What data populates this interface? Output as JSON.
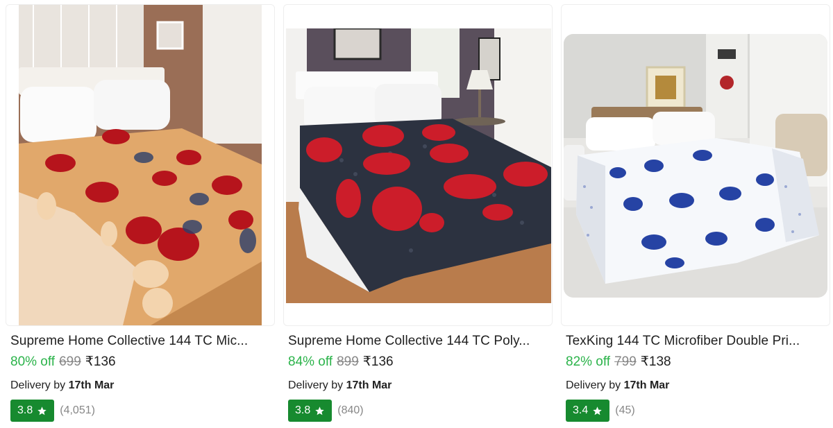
{
  "products": [
    {
      "title": "Supreme Home Collective 144 TC Mic...",
      "discount": "80% off",
      "mrp": "699",
      "price": "₹136",
      "delivery_prefix": "Delivery by",
      "delivery_date": "17th Mar",
      "rating": "3.8",
      "rating_count": "(4,051)",
      "star_icon": "star-icon"
    },
    {
      "title": "Supreme Home Collective 144 TC Poly...",
      "discount": "84% off",
      "mrp": "899",
      "price": "₹136",
      "delivery_prefix": "Delivery by",
      "delivery_date": "17th Mar",
      "rating": "3.8",
      "rating_count": "(840)",
      "star_icon": "star-icon"
    },
    {
      "title": "TexKing 144 TC Microfiber Double Pri...",
      "discount": "82% off",
      "mrp": "799",
      "price": "₹138",
      "delivery_prefix": "Delivery by",
      "delivery_date": "17th Mar",
      "rating": "3.4",
      "rating_count": "(45)",
      "star_icon": "star-icon"
    }
  ],
  "colors": {
    "discount": "#2bb34a",
    "rating_badge": "#178a2f",
    "muted": "#878787"
  }
}
